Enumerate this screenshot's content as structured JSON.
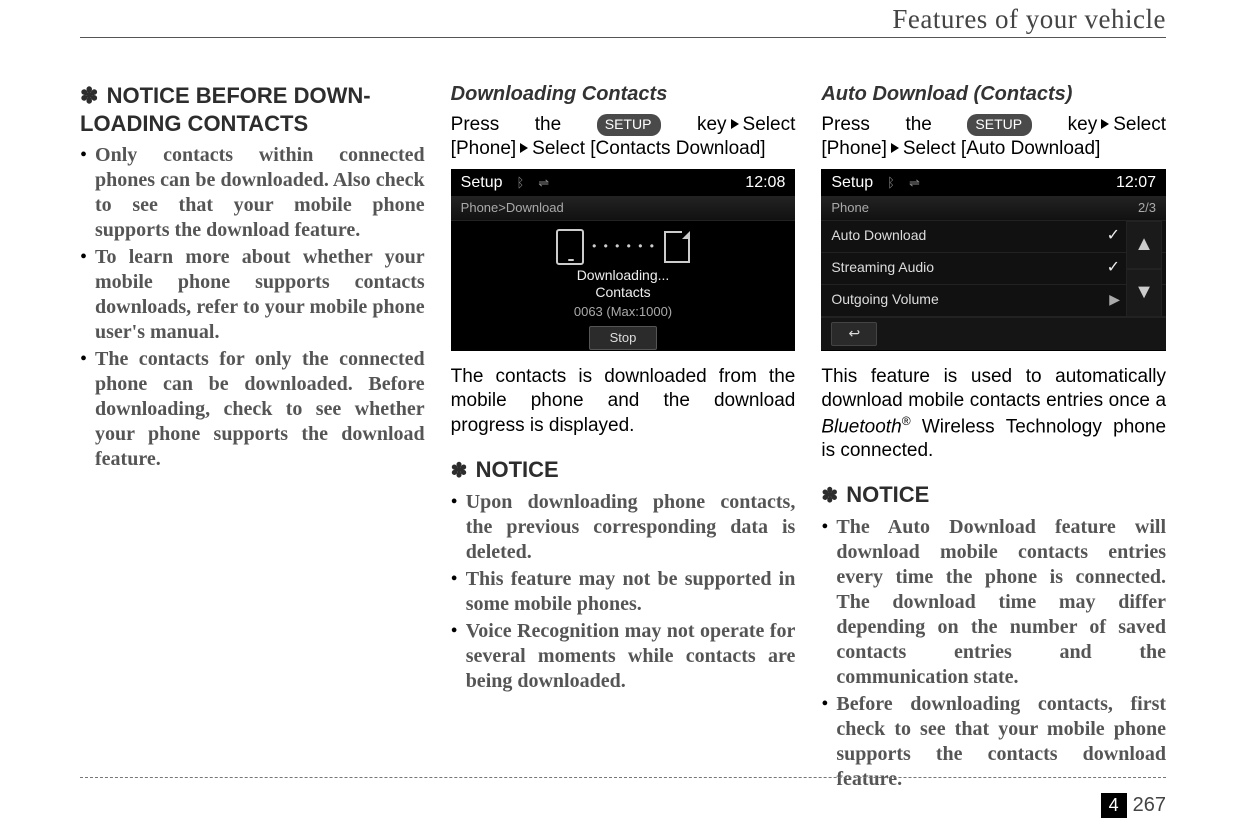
{
  "header": {
    "title": "Features of your vehicle"
  },
  "footer": {
    "chapter": "4",
    "page": "267"
  },
  "col1": {
    "noticeTitle": "NOTICE BEFORE DOWN-LOADING CONTACTS",
    "bullets": [
      "Only contacts within connected phones can be downloaded. Also check to see that your mobile phone supports the download feature.",
      "To learn more about whether your mobile phone supports contacts downloads, refer to your mobile phone user's manual.",
      "The contacts for only the connected phone can be downloaded. Before downloading, check to see whether your phone supports the download feature."
    ]
  },
  "col2": {
    "heading": "Downloading Contacts",
    "pressPre": "Press   the",
    "setup": "SETUP",
    "pressPost": "key",
    "sel1": "Select",
    "pressLine2a": "[Phone]",
    "pressLine2b": "Select [Contacts Download]",
    "screen": {
      "topTitle": "Setup",
      "time": "12:08",
      "crumb": "Phone>Download",
      "downloading": "Downloading...",
      "contacts": "Contacts",
      "counter": "0063 (Max:1000)",
      "stop": "Stop"
    },
    "body": "The contacts is downloaded from the mobile phone and the download progress is displayed.",
    "noticeTitle": "NOTICE",
    "noticeBullets": [
      "Upon downloading phone contacts, the previous corresponding data is deleted.",
      "This feature may not be supported in some mobile phones.",
      "Voice Recognition may not operate for several moments while contacts are being downloaded."
    ]
  },
  "col3": {
    "heading": "Auto Download (Contacts)",
    "pressPre": "Press   the",
    "setup": "SETUP",
    "pressPost": "key",
    "sel1": "Select",
    "pressLine2a": "[Phone]",
    "pressLine2b": "Select [Auto Download]",
    "screen": {
      "topTitle": "Setup",
      "time": "12:07",
      "crumb": "Phone",
      "pager": "2/3",
      "row1": "Auto Download",
      "row2": "Streaming Audio",
      "row3": "Outgoing Volume"
    },
    "bodyPre": "This feature is used to automatically download mobile contacts entries once a ",
    "bluetooth": "Bluetooth",
    "reg": "®",
    "bodyPost": " Wireless Technology phone is connected.",
    "noticeTitle": "NOTICE",
    "noticeBullets": [
      "The Auto Download feature will download mobile contacts entries every time the phone is connected. The download time may differ depending on the number of saved contacts entries and the communication state.",
      "Before downloading contacts, first check to see that your mobile phone supports the contacts download feature."
    ]
  }
}
